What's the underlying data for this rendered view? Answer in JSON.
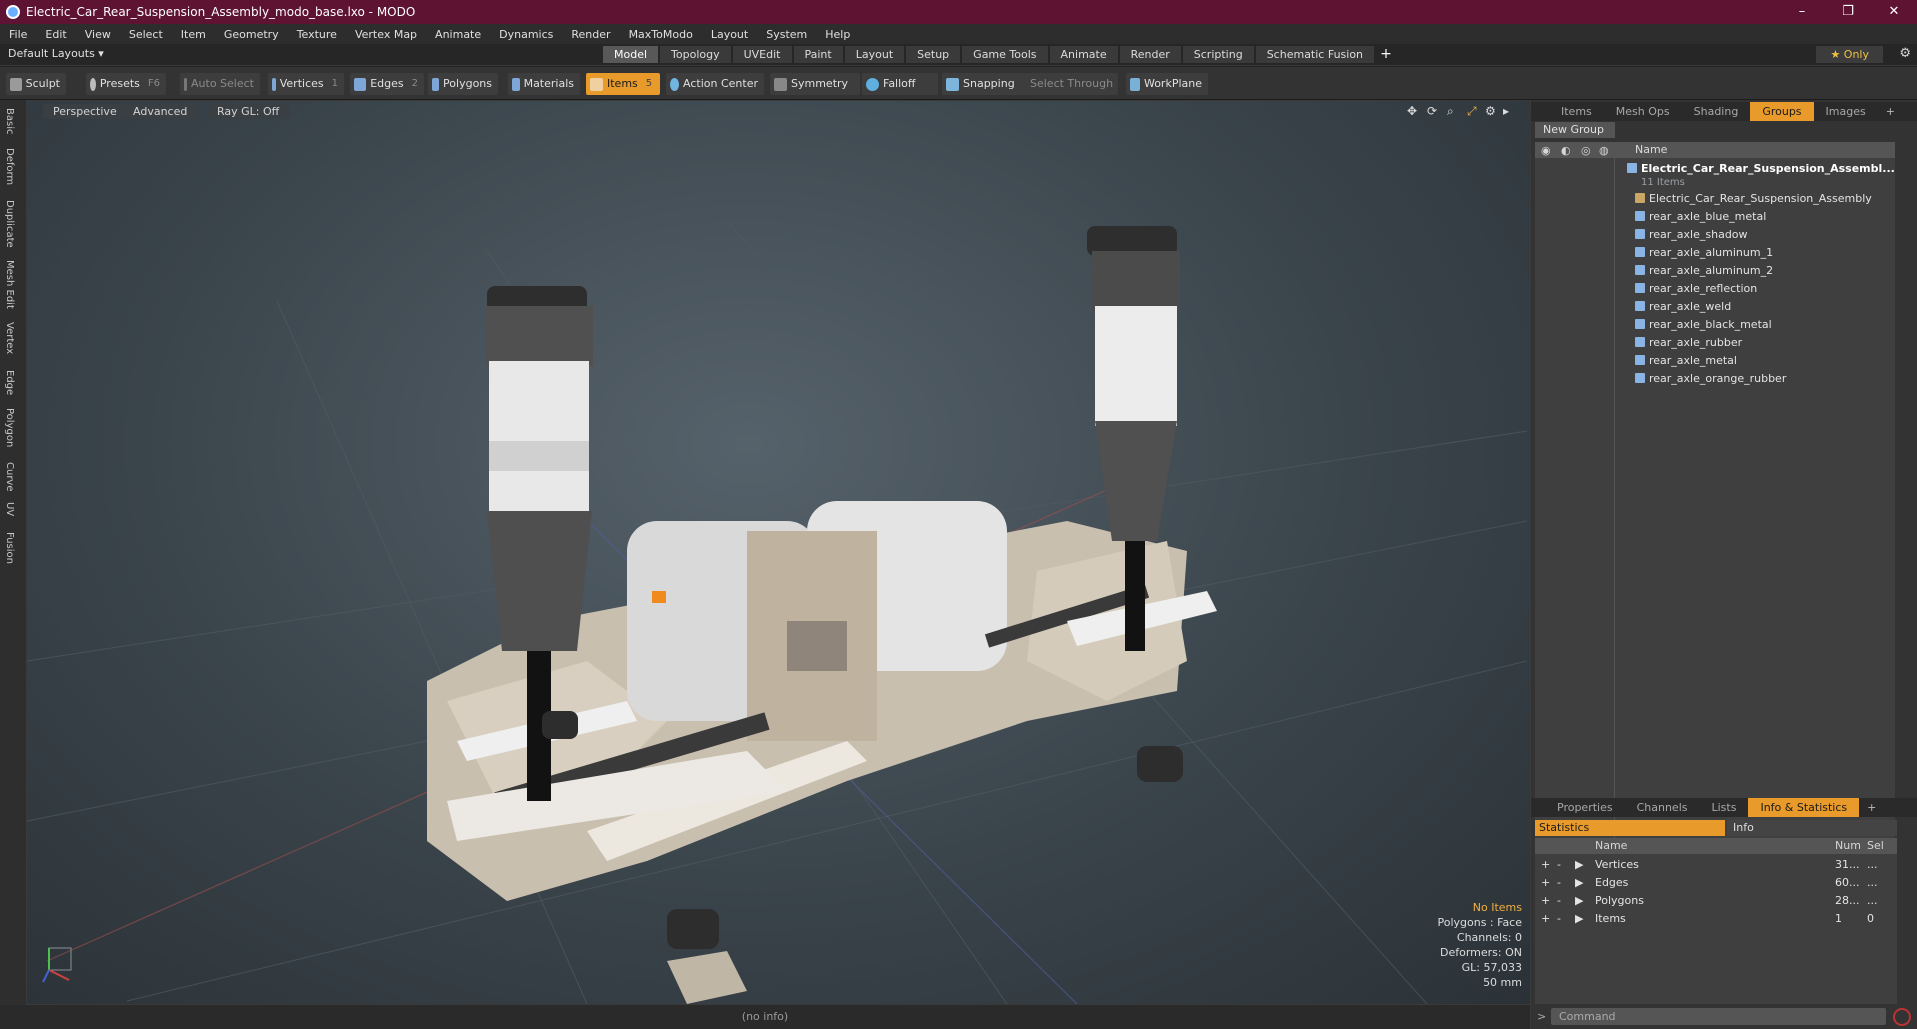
{
  "window": {
    "title": "Electric_Car_Rear_Suspension_Assembly_modo_base.lxo - MODO",
    "minimize": "–",
    "maximize": "❐",
    "close": "✕"
  },
  "menu": [
    "File",
    "Edit",
    "View",
    "Select",
    "Item",
    "Geometry",
    "Texture",
    "Vertex Map",
    "Animate",
    "Dynamics",
    "Render",
    "MaxToModo",
    "Layout",
    "System",
    "Help"
  ],
  "layouts": {
    "label": "Default Layouts ▾"
  },
  "modeTabs": [
    "Model",
    "Topology",
    "UVEdit",
    "Paint",
    "Layout",
    "Setup",
    "Game Tools",
    "Animate",
    "Render",
    "Scripting",
    "Schematic Fusion"
  ],
  "activeModeTab": "Model",
  "onlyButton": "★  Only",
  "toolbar": {
    "sculpt": "Sculpt",
    "presets": "Presets",
    "presetsKey": "F6",
    "autoSelect": "Auto Select",
    "vertices": "Vertices",
    "verticesKey": "1",
    "edges": "Edges",
    "edgesKey": "2",
    "polygons": "Polygons",
    "materials": "Materials",
    "items": "Items",
    "itemsKey": "5",
    "actionCenter": "Action Center",
    "symmetry": "Symmetry",
    "falloff": "Falloff",
    "snapping": "Snapping",
    "selectThrough": "Select Through",
    "workplane": "WorkPlane"
  },
  "leftStrip": [
    "Basic",
    "Deform",
    "Duplicate",
    "Mesh Edit",
    "Vertex",
    "Edge",
    "Polygon",
    "Curve",
    "UV",
    "Fusion"
  ],
  "viewport": {
    "perspective": "Perspective",
    "advanced": "Advanced",
    "rayGL": "Ray GL: Off",
    "info": {
      "noItems": "No Items",
      "polygons": "Polygons : Face",
      "channels": "Channels: 0",
      "deformers": "Deformers: ON",
      "gl": "GL: 57,033",
      "scale": "50 mm"
    }
  },
  "statusbar": "(no info)",
  "rightPanel": {
    "topTabs": [
      "Items",
      "Mesh Ops",
      "Shading",
      "Groups",
      "Images"
    ],
    "activeTopTab": "Groups",
    "newGroup": "New Group",
    "nameHeader": "Name",
    "rootName": "Electric_Car_Rear_Suspension_Assembl...",
    "rootSub": "11 Items",
    "children": [
      "Electric_Car_Rear_Suspension_Assembly",
      "rear_axle_blue_metal",
      "rear_axle_shadow",
      "rear_axle_aluminum_1",
      "rear_axle_aluminum_2",
      "rear_axle_reflection",
      "rear_axle_weld",
      "rear_axle_black_metal",
      "rear_axle_rubber",
      "rear_axle_metal",
      "rear_axle_orange_rubber"
    ],
    "bottomTabs": [
      "Properties",
      "Channels",
      "Lists",
      "Info & Statistics"
    ],
    "activeBottomTab": "Info & Statistics",
    "statistics": "Statistics",
    "info": "Info",
    "statHeaders": {
      "name": "Name",
      "num": "Num",
      "sel": "Sel"
    },
    "stats": [
      {
        "name": "Vertices",
        "num": "31...",
        "sel": "..."
      },
      {
        "name": "Edges",
        "num": "60...",
        "sel": "..."
      },
      {
        "name": "Polygons",
        "num": "28...",
        "sel": "..."
      },
      {
        "name": "Items",
        "num": "1",
        "sel": "0"
      }
    ],
    "command": "Command"
  }
}
